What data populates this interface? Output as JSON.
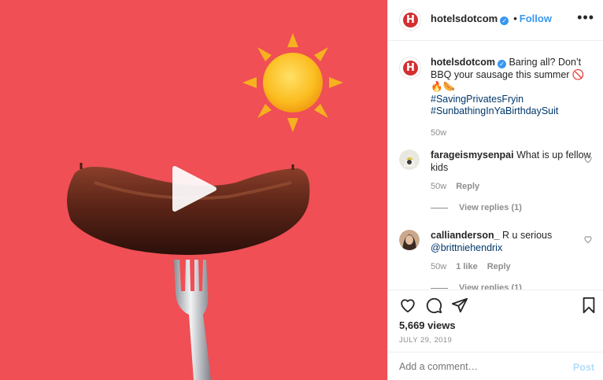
{
  "media": {
    "background_color": "#ef4f55",
    "sun_emoji": "sun",
    "play_icon": "play-icon"
  },
  "header": {
    "username": "hotelsdotcom",
    "dot": "•",
    "follow_label": "Follow",
    "more_label": "•••",
    "logo_letter": "H"
  },
  "caption": {
    "username": "hotelsdotcom",
    "text": "Baring all? Don’t BBQ your sausage this summer 🚫🔥🌭",
    "hashtags": [
      "#SavingPrivatesFryin",
      "#SunbathingInYaBirthdaySuit"
    ],
    "time": "50w"
  },
  "comments": [
    {
      "username": "farageismysenpai",
      "text": "What is up fellow kids",
      "time": "50w",
      "reply_label": "Reply",
      "view_replies": "View replies (1)"
    },
    {
      "username": "callianderson_",
      "text": "R u serious",
      "mention": "@brittniehendrix",
      "time": "50w",
      "likes": "1 like",
      "reply_label": "Reply",
      "view_replies": "View replies (1)"
    }
  ],
  "stats": {
    "views": "5,669 views",
    "date": "JULY 29, 2019"
  },
  "add_comment": {
    "placeholder": "Add a comment…",
    "post_label": "Post"
  },
  "colors": {
    "accent": "#3897f0",
    "link": "#00376b",
    "muted": "#8e8e8e",
    "brand_red": "#d32f2f"
  }
}
